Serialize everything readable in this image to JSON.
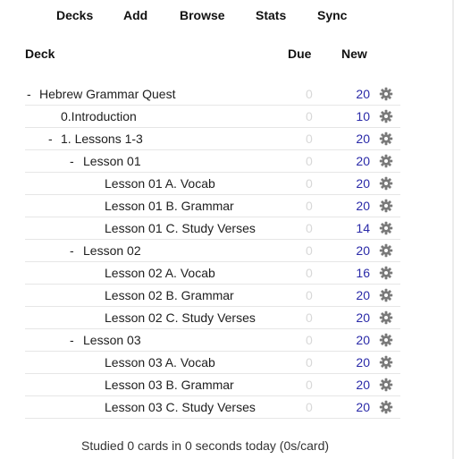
{
  "nav": {
    "decks": "Decks",
    "add": "Add",
    "browse": "Browse",
    "stats": "Stats",
    "sync": "Sync"
  },
  "columns": {
    "deck": "Deck",
    "due": "Due",
    "new": "New"
  },
  "rows": [
    {
      "collapse": "-",
      "name": "Hebrew Grammar Quest",
      "due": "0",
      "new": "20"
    },
    {
      "collapse": "",
      "name": "0.Introduction",
      "due": "0",
      "new": "10"
    },
    {
      "collapse": "-",
      "name": "1. Lessons 1-3",
      "due": "0",
      "new": "20"
    },
    {
      "collapse": "-",
      "name": "Lesson 01",
      "due": "0",
      "new": "20"
    },
    {
      "collapse": "",
      "name": "Lesson 01 A. Vocab",
      "due": "0",
      "new": "20"
    },
    {
      "collapse": "",
      "name": "Lesson 01 B. Grammar",
      "due": "0",
      "new": "20"
    },
    {
      "collapse": "",
      "name": "Lesson 01 C. Study Verses",
      "due": "0",
      "new": "14"
    },
    {
      "collapse": "-",
      "name": "Lesson 02",
      "due": "0",
      "new": "20"
    },
    {
      "collapse": "",
      "name": "Lesson 02 A. Vocab",
      "due": "0",
      "new": "16"
    },
    {
      "collapse": "",
      "name": "Lesson 02 B. Grammar",
      "due": "0",
      "new": "20"
    },
    {
      "collapse": "",
      "name": "Lesson 02 C. Study Verses",
      "due": "0",
      "new": "20"
    },
    {
      "collapse": "-",
      "name": "Lesson 03",
      "due": "0",
      "new": "20"
    },
    {
      "collapse": "",
      "name": "Lesson 03 A. Vocab",
      "due": "0",
      "new": "20"
    },
    {
      "collapse": "",
      "name": "Lesson 03 B. Grammar",
      "due": "0",
      "new": "20"
    },
    {
      "collapse": "",
      "name": "Lesson 03 C. Study Verses",
      "due": "0",
      "new": "20"
    }
  ],
  "footer": {
    "studied": "Studied 0 cards in 0 seconds today (0s/card)"
  },
  "icons": {
    "options": "gear-icon"
  },
  "colors": {
    "new_count": "#2a2aa8",
    "due_zero": "#d8d8d8"
  }
}
